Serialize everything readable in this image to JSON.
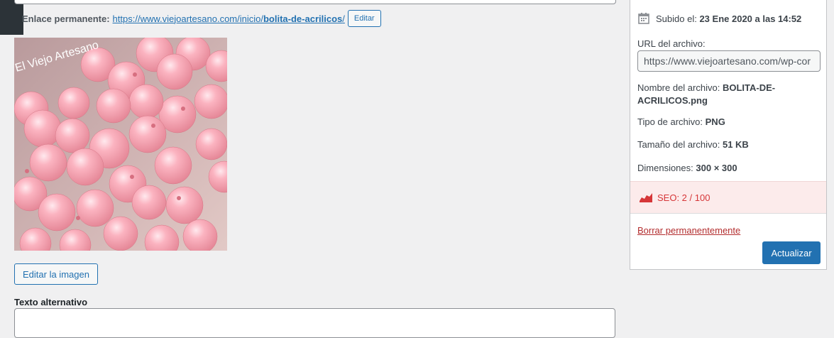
{
  "permalink": {
    "label": "Enlace permanente:",
    "url_base": "https://www.viejoartesano.com/inicio/",
    "url_slug": "bolita-de-acrilicos",
    "url_end": "/",
    "edit_label": "Editar"
  },
  "image": {
    "watermark": "El Viejo Artesano"
  },
  "edit_image_label": "Editar la imagen",
  "alt_text": {
    "label": "Texto alternativo",
    "value": ""
  },
  "sidebar": {
    "uploaded_label": "Subido el:",
    "uploaded_value": "23 Ene 2020 a las 14:52",
    "url_label": "URL del archivo:",
    "url_value": "https://www.viejoartesano.com/wp-cor",
    "filename_label": "Nombre del archivo:",
    "filename_value": "BOLITA-DE-ACRILICOS.png",
    "filetype_label": "Tipo de archivo:",
    "filetype_value": "PNG",
    "filesize_label": "Tamaño del archivo:",
    "filesize_value": "51 KB",
    "dimensions_label": "Dimensiones:",
    "dimensions_value": "300 × 300",
    "seo_label": "SEO: 2 / 100",
    "delete_label": "Borrar permanentemente",
    "update_label": "Actualizar"
  },
  "colors": {
    "accent": "#2271b1",
    "danger": "#d63638",
    "seo_bg": "#fcebeb"
  }
}
